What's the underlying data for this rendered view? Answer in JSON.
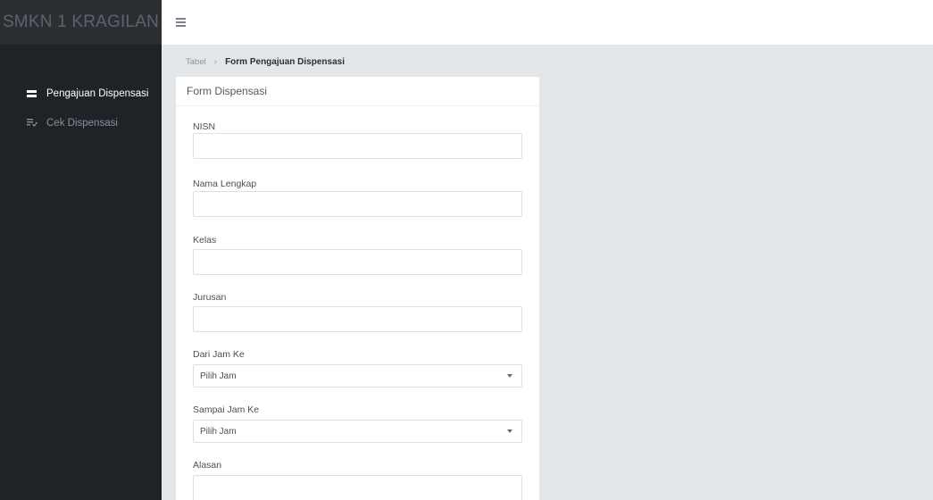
{
  "sidebar": {
    "brand": "SMKN 1 KRAGILAN",
    "items": [
      {
        "label": "Pengajuan Dispensasi",
        "icon": "list-icon",
        "active": true
      },
      {
        "label": "Cek Dispensasi",
        "icon": "checklist-icon",
        "active": false
      }
    ]
  },
  "header": {
    "menu_icon": "hamburger-icon"
  },
  "breadcrumb": {
    "parent": "Tabel",
    "separator": "›",
    "current": "Form Pengajuan Dispensasi"
  },
  "form": {
    "title": "Form Dispensasi",
    "fields": {
      "nisn": {
        "label": "NISN",
        "value": "",
        "placeholder": ""
      },
      "nama": {
        "label": "Nama Lengkap",
        "value": "",
        "placeholder": ""
      },
      "kelas": {
        "label": "Kelas",
        "value": "",
        "placeholder": ""
      },
      "jurusan": {
        "label": "Jurusan",
        "value": "",
        "placeholder": ""
      },
      "dari_jam": {
        "label": "Dari Jam Ke",
        "selected": "Pilih Jam"
      },
      "sampai_jam": {
        "label": "Sampai Jam Ke",
        "selected": "Pilih Jam"
      },
      "alasan": {
        "label": "Alasan",
        "value": "",
        "placeholder": ""
      }
    }
  },
  "colors": {
    "sidebar_bg": "#1f2328",
    "brand_bg": "#2b2f34",
    "content_bg": "#e4e7ea",
    "card_bg": "#ffffff"
  }
}
